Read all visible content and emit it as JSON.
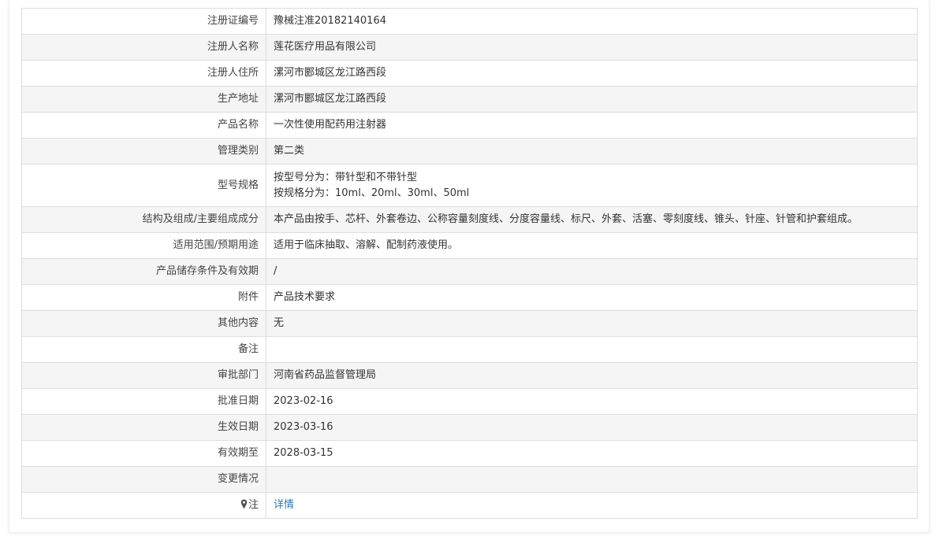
{
  "rows": [
    {
      "label": "注册证编号",
      "value": "豫械注准20182140164"
    },
    {
      "label": "注册人名称",
      "value": "莲花医疗用品有限公司"
    },
    {
      "label": "注册人住所",
      "value": "漯河市郾城区龙江路西段"
    },
    {
      "label": "生产地址",
      "value": "漯河市郾城区龙江路西段"
    },
    {
      "label": "产品名称",
      "value": "一次性使用配药用注射器"
    },
    {
      "label": "管理类别",
      "value": "第二类"
    },
    {
      "label": "型号规格",
      "value_line1": "按型号分为：带针型和不带针型",
      "value_line2": "按规格分为：10ml、20ml、30ml、50ml"
    },
    {
      "label": "结构及组成/主要组成成分",
      "value": "本产品由按手、芯杆、外套卷边、公称容量刻度线、分度容量线、标尺、外套、活塞、零刻度线、锥头、针座、针管和护套组成。"
    },
    {
      "label": "适用范围/预期用途",
      "value": "适用于临床抽取、溶解、配制药液使用。"
    },
    {
      "label": "产品储存条件及有效期",
      "value": "/"
    },
    {
      "label": "附件",
      "value": "产品技术要求"
    },
    {
      "label": "其他内容",
      "value": "无"
    },
    {
      "label": "备注",
      "value": ""
    },
    {
      "label": "审批部门",
      "value": "河南省药品监督管理局"
    },
    {
      "label": "批准日期",
      "value": "2023-02-16"
    },
    {
      "label": "生效日期",
      "value": "2023-03-16"
    },
    {
      "label": "有效期至",
      "value": "2028-03-15"
    },
    {
      "label": "变更情况",
      "value": ""
    },
    {
      "label": "注",
      "value": "详情"
    }
  ],
  "icons": {
    "note": "map-pin-icon"
  },
  "colors": {
    "link": "#2a7ab8",
    "stripe": "#f5f5f5",
    "border": "#dddddd"
  }
}
